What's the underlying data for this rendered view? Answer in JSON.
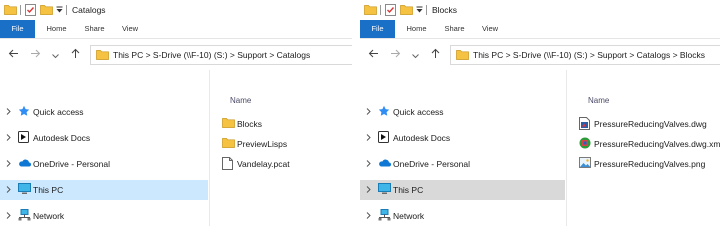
{
  "windows": [
    {
      "title": "Catalogs",
      "ribbon": {
        "file": "File",
        "home": "Home",
        "share": "Share",
        "view": "View"
      },
      "address": {
        "path": "This PC  >  S-Drive (\\\\F-10) (S:)  >  Support  >  Catalogs"
      },
      "nav": [
        {
          "label": "Quick access",
          "icon": "star-icon"
        },
        {
          "label": "Autodesk Docs",
          "icon": "autodesk-drive-icon"
        },
        {
          "label": "OneDrive - Personal",
          "icon": "onedrive-cloud-icon"
        },
        {
          "label": "This PC",
          "icon": "computer-icon",
          "selected": true
        },
        {
          "label": "Network",
          "icon": "network-icon"
        }
      ],
      "column_header": "Name",
      "files": [
        {
          "name": "Blocks",
          "type": "folder"
        },
        {
          "name": "PreviewLisps",
          "type": "folder"
        },
        {
          "name": "Vandelay.pcat",
          "type": "document"
        }
      ]
    },
    {
      "title": "Blocks",
      "ribbon": {
        "file": "File",
        "home": "Home",
        "share": "Share",
        "view": "View"
      },
      "address": {
        "path": "This PC  >  S-Drive (\\\\F-10) (S:)  >  Support  >  Catalogs  >  Blocks"
      },
      "nav": [
        {
          "label": "Quick access",
          "icon": "star-icon"
        },
        {
          "label": "Autodesk Docs",
          "icon": "autodesk-drive-icon"
        },
        {
          "label": "OneDrive - Personal",
          "icon": "onedrive-cloud-icon"
        },
        {
          "label": "This PC",
          "icon": "computer-icon",
          "selected": true
        },
        {
          "label": "Network",
          "icon": "network-icon"
        }
      ],
      "column_header": "Name",
      "files": [
        {
          "name": "PressureReducingValves.dwg",
          "type": "dwg"
        },
        {
          "name": "PressureReducingValves.dwg.xml",
          "type": "xml"
        },
        {
          "name": "PressureReducingValves.png",
          "type": "png"
        }
      ]
    }
  ],
  "colors": {
    "file_tab": "#1a6fc7",
    "selected_active": "#cce8ff",
    "selected_inactive": "#d9d9d9",
    "folder": "#f5c242"
  }
}
